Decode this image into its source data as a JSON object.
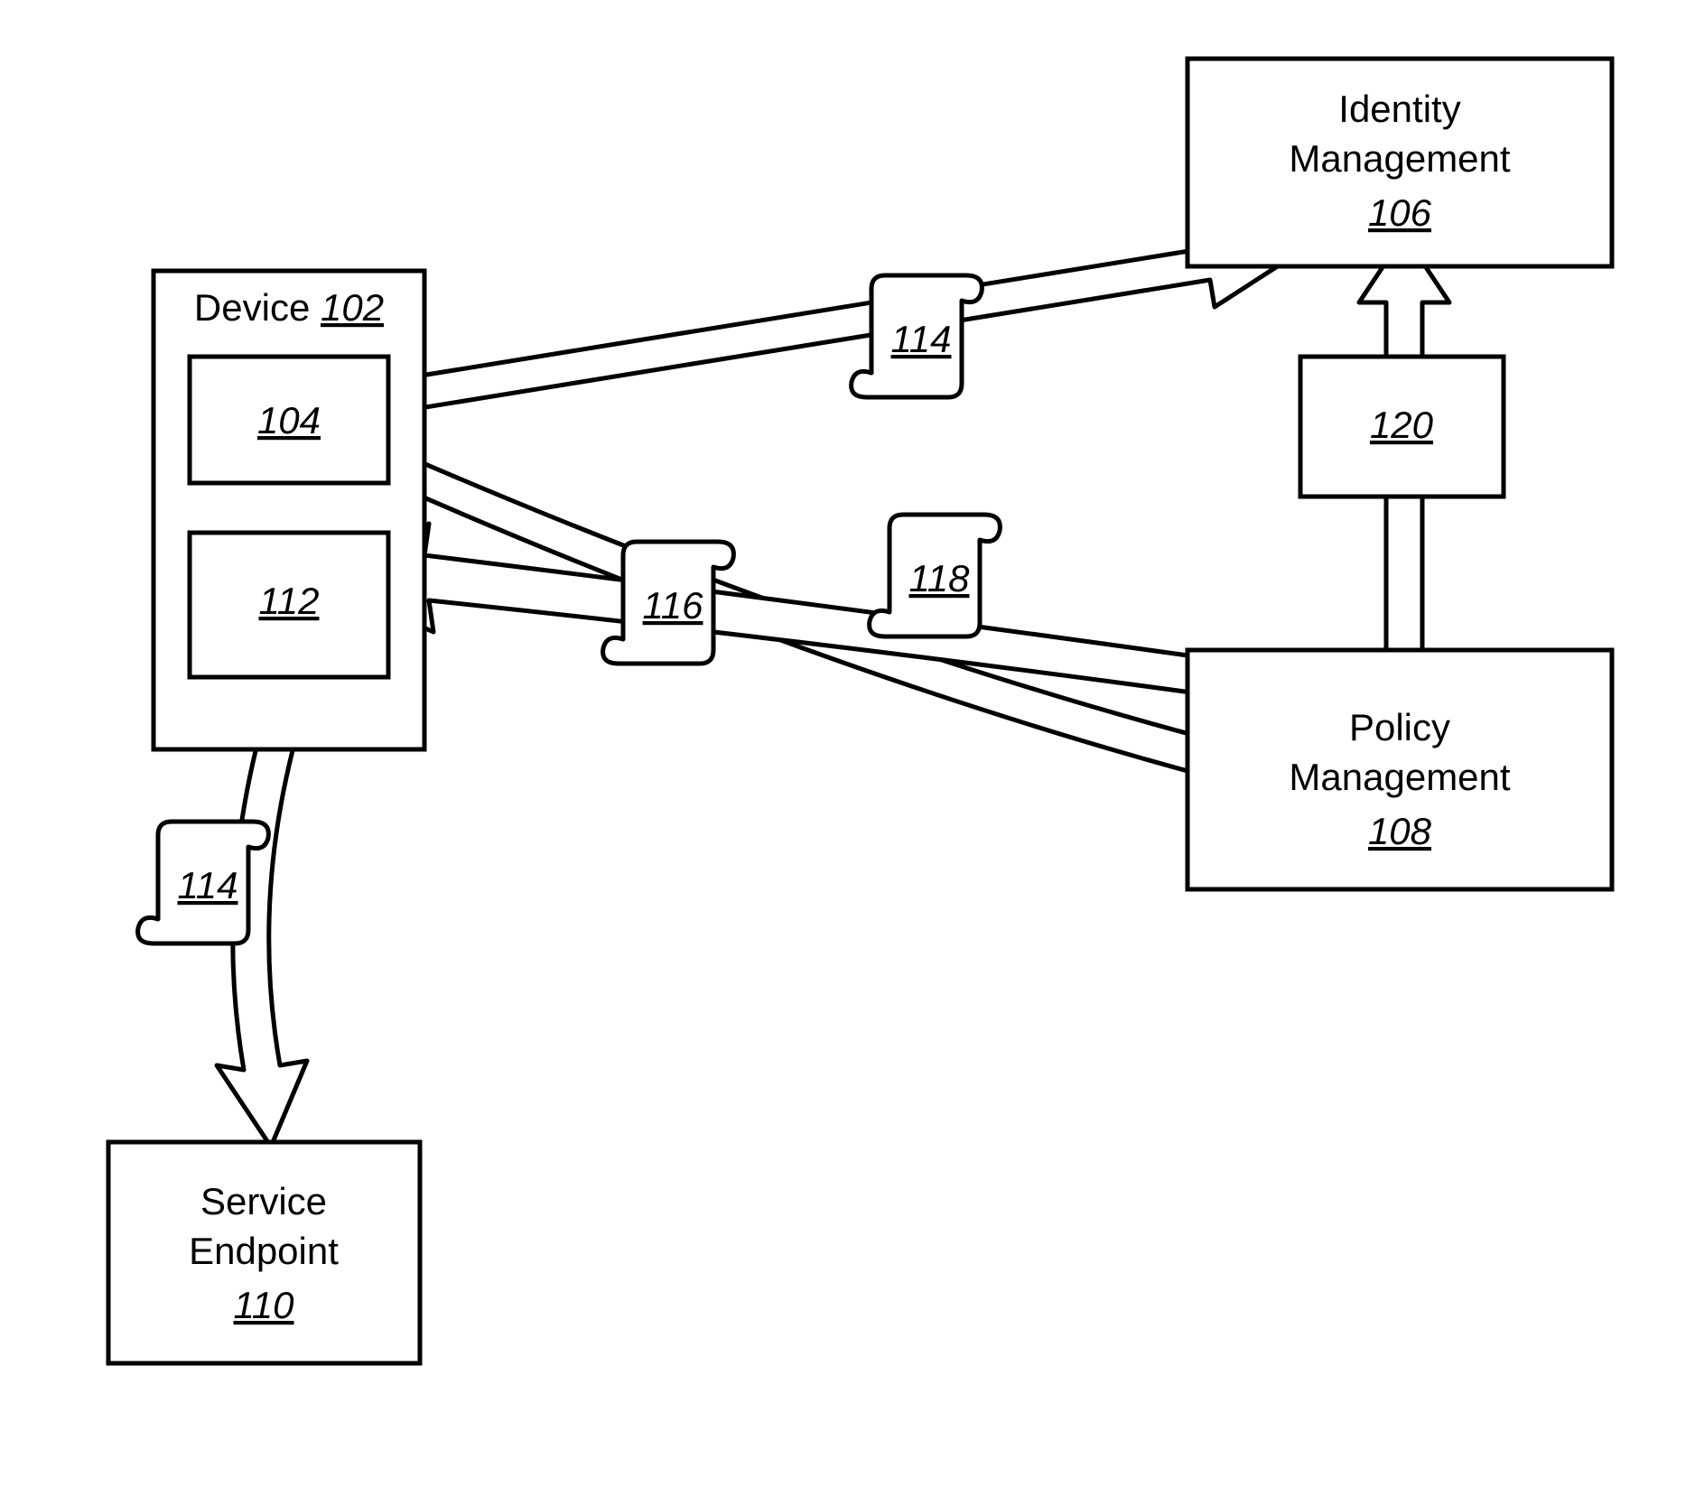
{
  "boxes": {
    "device": {
      "label": "Device",
      "ref": "102"
    },
    "sub104": {
      "ref": "104"
    },
    "sub112": {
      "ref": "112"
    },
    "identity": {
      "label1": "Identity",
      "label2": "Management",
      "ref": "106"
    },
    "policy": {
      "label1": "Policy",
      "label2": "Management",
      "ref": "108"
    },
    "service": {
      "label1": "Service",
      "label2": "Endpoint",
      "ref": "110"
    },
    "box120": {
      "ref": "120"
    }
  },
  "scrolls": {
    "s114a": {
      "ref": "114"
    },
    "s114b": {
      "ref": "114"
    },
    "s116": {
      "ref": "116"
    },
    "s118": {
      "ref": "118"
    }
  }
}
